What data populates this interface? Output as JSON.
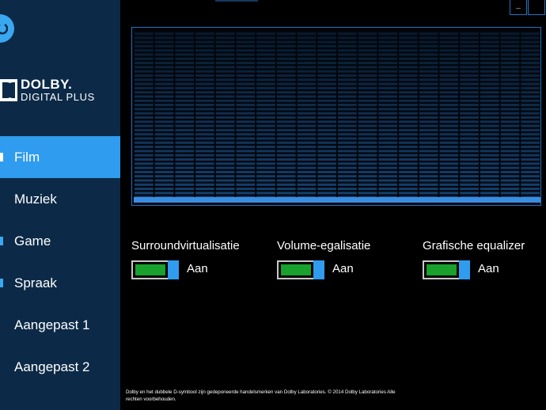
{
  "app": {
    "logo_brand": "DOLBY.",
    "logo_product": "DIGITAL PLUS",
    "power_icon": "power-icon"
  },
  "window_controls": {
    "minimize": "_"
  },
  "sidebar": {
    "items": [
      {
        "label": "Film",
        "active": true
      },
      {
        "label": "Muziek",
        "active": false
      },
      {
        "label": "Game",
        "active": false
      },
      {
        "label": "Spraak",
        "active": false
      },
      {
        "label": "Aangepast 1",
        "active": false
      },
      {
        "label": "Aangepast 2",
        "active": false
      }
    ]
  },
  "equalizer": {
    "bands": 20,
    "level": 0.03
  },
  "controls": [
    {
      "label": "Surroundvirtualisatie",
      "state": "Aan",
      "on": true
    },
    {
      "label": "Volume-egalisatie",
      "state": "Aan",
      "on": true
    },
    {
      "label": "Grafische equalizer",
      "state": "Aan",
      "on": true
    }
  ],
  "footer": {
    "text": "Dolby en het dubbele D-symbool zijn gedeponeerde handelsmerken van Dolby Laboratories. © 2014 Dolby Laboratories Alle rechten voorbehouden."
  },
  "colors": {
    "sidebar_bg": "#0c2a47",
    "accent": "#2f9cef",
    "toggle_on": "#18a12c",
    "eq_bar": "#1d5c9c"
  }
}
